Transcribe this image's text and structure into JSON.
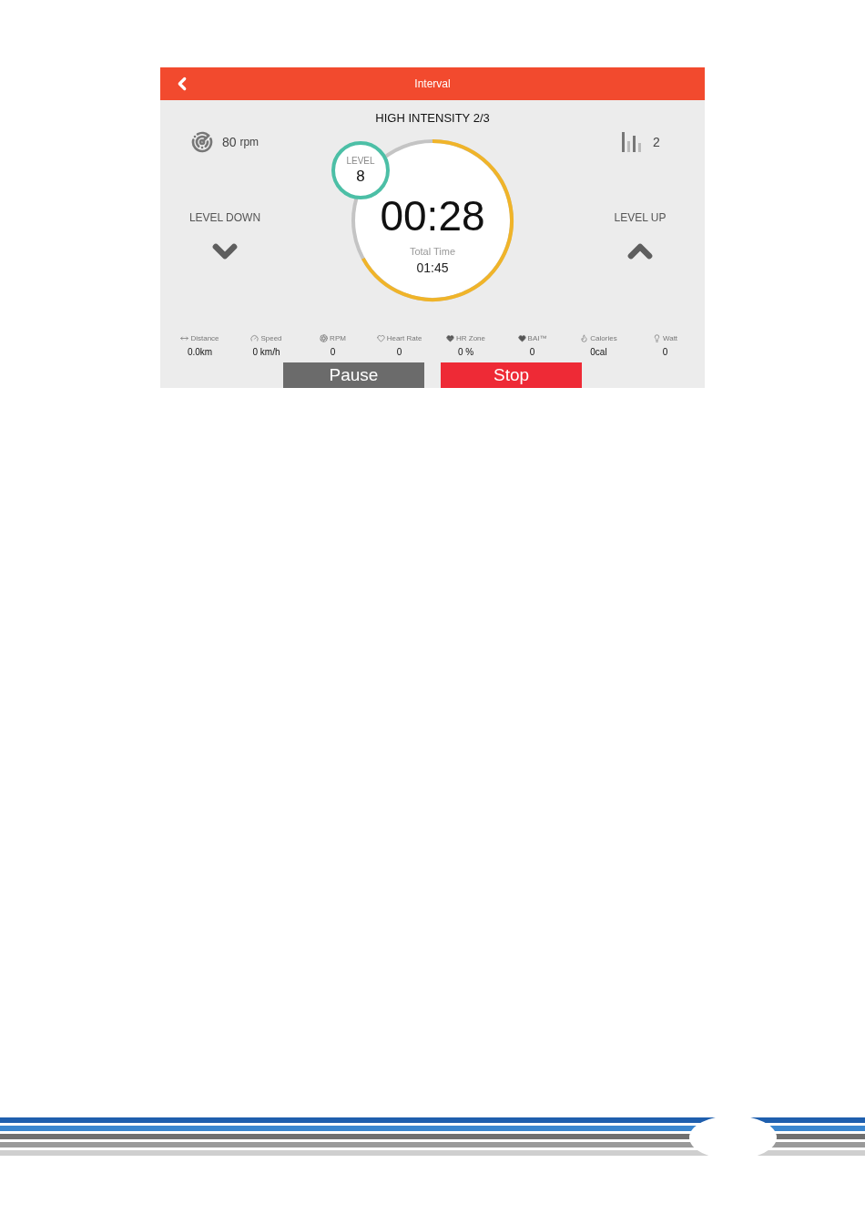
{
  "header": {
    "title": "Interval"
  },
  "workout": {
    "title": "HIGH INTENSITY 2/3"
  },
  "cadence": {
    "reading": "80",
    "unit": "rpm"
  },
  "segment": {
    "reading": "2"
  },
  "level_down": {
    "label": "LEVEL DOWN"
  },
  "level_up": {
    "label": "LEVEL UP"
  },
  "level_badge": {
    "label": "LEVEL",
    "value": "8"
  },
  "timer": {
    "time": "00:28",
    "total_label": "Total Time",
    "total": "01:45"
  },
  "stats": [
    {
      "kind": "distance",
      "label": "Distance",
      "value": "0.0km"
    },
    {
      "kind": "speed",
      "label": "Speed",
      "value": "0 km/h"
    },
    {
      "kind": "rpm",
      "label": "RPM",
      "value": "0"
    },
    {
      "kind": "heart_rate",
      "label": "Heart Rate",
      "value": "0"
    },
    {
      "kind": "hr_zone",
      "label": "HR Zone",
      "value": "0 %"
    },
    {
      "kind": "bai",
      "label": "BAI™",
      "value": "0"
    },
    {
      "kind": "calories",
      "label": "Calories",
      "value": "0cal"
    },
    {
      "kind": "watt",
      "label": "Watt",
      "value": "0"
    }
  ],
  "buttons": [
    {
      "kind": "pause",
      "label": "Pause"
    },
    {
      "kind": "stop",
      "label": "Stop"
    }
  ]
}
